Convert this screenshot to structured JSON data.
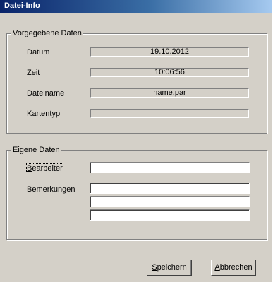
{
  "window": {
    "title": "Datei-Info"
  },
  "predefined": {
    "legend": "Vorgegebene Daten",
    "fields": [
      {
        "label": "Datum",
        "value": "19.10.2012"
      },
      {
        "label": "Zeit",
        "value": "10:06:56"
      },
      {
        "label": "Dateiname",
        "value": "name.par"
      },
      {
        "label": "Kartentyp",
        "value": ""
      }
    ]
  },
  "own": {
    "legend": "Eigene Daten",
    "editor": {
      "accel": "B",
      "rest": "earbeiter",
      "value": ""
    },
    "remarks": {
      "label": "Bemerkungen",
      "lines": [
        "",
        "",
        ""
      ]
    }
  },
  "buttons": {
    "save": {
      "accel": "S",
      "rest": "peichern"
    },
    "cancel": {
      "accel": "A",
      "rest": "bbrechen"
    }
  }
}
